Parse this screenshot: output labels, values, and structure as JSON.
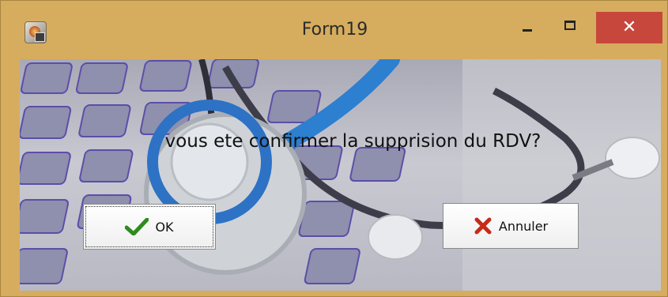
{
  "window": {
    "title": "Form19",
    "close_glyph": "✕"
  },
  "dialog": {
    "message": "vous ete confirmer la supprision du RDV?",
    "ok_label": "OK",
    "cancel_label": "Annuler"
  },
  "icons": {
    "app": "app-icon",
    "ok": "check-icon",
    "cancel": "x-icon"
  },
  "colors": {
    "frame": "#d6ad5e",
    "close": "#c7473c",
    "check": "#2e8b1e",
    "x": "#c62a1a"
  }
}
